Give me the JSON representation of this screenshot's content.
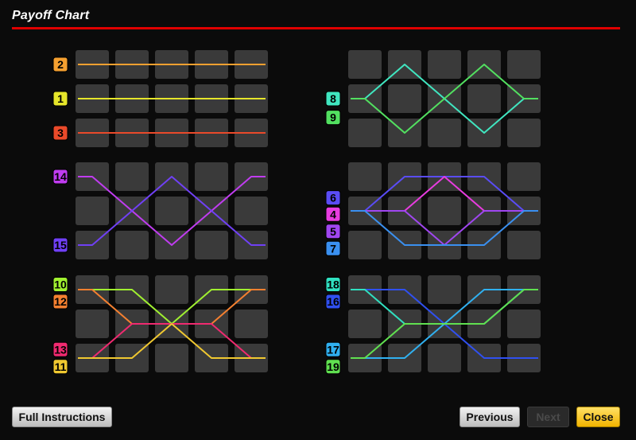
{
  "title": "Payoff Chart",
  "buttons": {
    "full_instructions": "Full Instructions",
    "previous": "Previous",
    "next": "Next",
    "close": "Close"
  },
  "colors": {
    "title_rule": "#e00000",
    "cell": "#3a3a3a",
    "close_button": "#f2b400"
  },
  "payline_colors": {
    "1": "#e6e62a",
    "2": "#f5a030",
    "3": "#ea4a2a",
    "4": "#e83ce0",
    "5": "#a046f0",
    "6": "#5a4cf5",
    "7": "#3a90f0",
    "8": "#40e6c0",
    "9": "#52e060",
    "10": "#a0f030",
    "11": "#f0c830",
    "12": "#f58030",
    "13": "#f02a70",
    "14": "#c03cf0",
    "15": "#7040f5",
    "16": "#3050f0",
    "17": "#30b0f0",
    "18": "#30e0c0",
    "19": "#60e050"
  },
  "grids": [
    {
      "name": "grid-top-left",
      "lines": [
        {
          "id": "2",
          "rows": [
            0,
            0,
            0,
            0,
            0
          ]
        },
        {
          "id": "1",
          "rows": [
            1,
            1,
            1,
            1,
            1
          ]
        },
        {
          "id": "3",
          "rows": [
            2,
            2,
            2,
            2,
            2
          ]
        }
      ],
      "labels": [
        {
          "id": "2",
          "row": 0
        },
        {
          "id": "1",
          "row": 1
        },
        {
          "id": "3",
          "row": 2
        }
      ]
    },
    {
      "name": "grid-mid-left",
      "lines": [
        {
          "id": "6",
          "rows": [
            1,
            0,
            0,
            0,
            1
          ]
        },
        {
          "id": "4",
          "rows": [
            1,
            1,
            0,
            1,
            1
          ]
        },
        {
          "id": "5",
          "rows": [
            1,
            1,
            2,
            1,
            1
          ]
        },
        {
          "id": "7",
          "rows": [
            1,
            2,
            2,
            2,
            1
          ]
        }
      ],
      "labels": [
        {
          "id": "6",
          "row": 0.62
        },
        {
          "id": "4",
          "row": 1.1
        },
        {
          "id": "5",
          "row": 1.6
        },
        {
          "id": "7",
          "row": 2.1
        }
      ]
    },
    {
      "name": "grid-bottom-left",
      "lines": [
        {
          "id": "8",
          "rows": [
            1,
            0,
            1,
            2,
            1
          ]
        },
        {
          "id": "9",
          "rows": [
            1,
            2,
            1,
            0,
            1
          ]
        }
      ],
      "labels": [
        {
          "id": "8",
          "row": 1
        },
        {
          "id": "9",
          "row": 1.55
        }
      ]
    },
    {
      "name": "grid-top-right",
      "lines": [
        {
          "id": "10",
          "rows": [
            0,
            0,
            1,
            0,
            0
          ]
        },
        {
          "id": "12",
          "rows": [
            0,
            1,
            1,
            1,
            0
          ]
        },
        {
          "id": "13",
          "rows": [
            2,
            1,
            1,
            1,
            2
          ]
        },
        {
          "id": "11",
          "rows": [
            2,
            2,
            1,
            2,
            2
          ]
        }
      ],
      "labels": [
        {
          "id": "10",
          "row": -0.15
        },
        {
          "id": "12",
          "row": 0.35
        },
        {
          "id": "13",
          "row": 1.75
        },
        {
          "id": "11",
          "row": 2.25
        }
      ]
    },
    {
      "name": "grid-mid-right",
      "lines": [
        {
          "id": "14",
          "rows": [
            0,
            1,
            2,
            1,
            0
          ]
        },
        {
          "id": "15",
          "rows": [
            2,
            1,
            0,
            1,
            2
          ]
        }
      ],
      "labels": [
        {
          "id": "14",
          "row": 0
        },
        {
          "id": "15",
          "row": 2
        }
      ]
    },
    {
      "name": "grid-bottom-right",
      "lines": [
        {
          "id": "16",
          "rows": [
            0,
            0,
            1,
            2,
            2
          ]
        },
        {
          "id": "18",
          "rows": [
            0,
            1,
            1,
            1,
            0
          ]
        },
        {
          "id": "17",
          "rows": [
            2,
            2,
            1,
            0,
            0
          ]
        },
        {
          "id": "19",
          "rows": [
            2,
            1,
            1,
            1,
            0
          ]
        }
      ],
      "labels": [
        {
          "id": "18",
          "row": -0.15
        },
        {
          "id": "16",
          "row": 0.35
        },
        {
          "id": "17",
          "row": 1.75
        },
        {
          "id": "19",
          "row": 2.25
        }
      ]
    }
  ]
}
